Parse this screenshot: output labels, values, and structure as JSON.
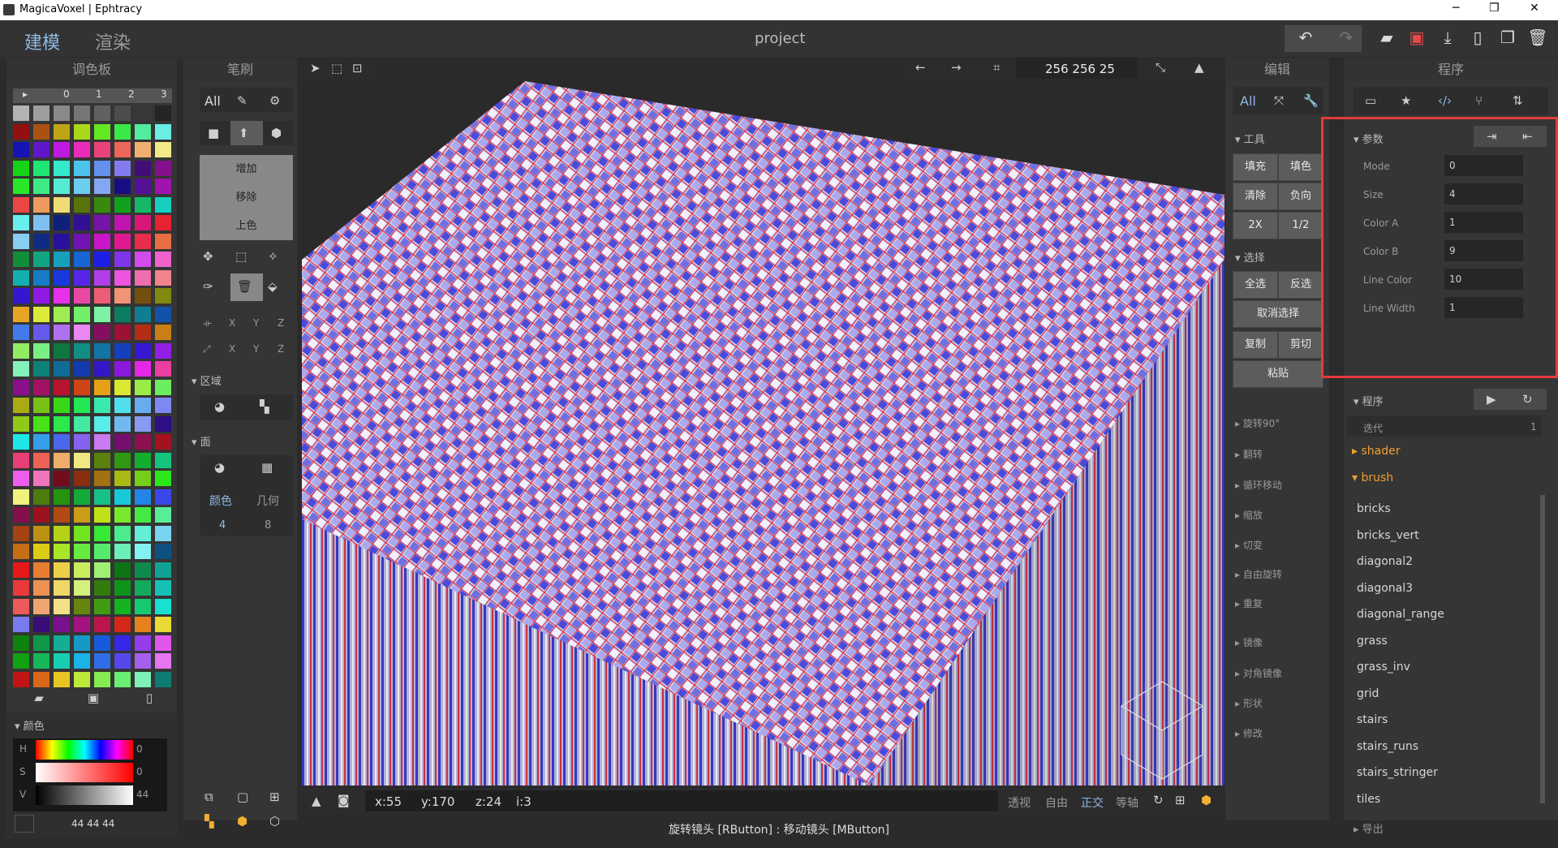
{
  "window": {
    "title": "MagicaVoxel | Ephtracy",
    "minimize": "─",
    "maximize": "❐",
    "close": "✕"
  },
  "topbar": {
    "tab_model": "建模",
    "tab_render": "渲染",
    "project": "project"
  },
  "palette": {
    "title": "调色板",
    "cols": [
      "▸",
      "0",
      "1",
      "2",
      "3"
    ],
    "selected_color": "#2b2b2b"
  },
  "brush": {
    "title": "笔刷",
    "all": "All",
    "modes": [
      "增加",
      "移除",
      "上色"
    ],
    "axes": [
      "X",
      "Y",
      "Z"
    ],
    "region_label": "区域",
    "face_label": "面",
    "face_color_label": "颜色",
    "face_geo_label": "几何",
    "face_color_val": "4",
    "face_geo_val": "8"
  },
  "color_panel": {
    "title": "颜色",
    "h_label": "H",
    "s_label": "S",
    "v_label": "V",
    "h_val": "0",
    "s_val": "0",
    "v_val": "44",
    "rgb": "44  44  44"
  },
  "viewport_bar": {
    "size": "256  256  25"
  },
  "coord_bar": {
    "x": "x:55",
    "y": "y:170",
    "z": "z:24",
    "i": "i:3"
  },
  "view_modes": [
    "透视",
    "自由",
    "正交",
    "等轴"
  ],
  "edit": {
    "title": "编辑",
    "all": "All",
    "tools_label": "工具",
    "tools": [
      "填充",
      "填色",
      "清除",
      "负向",
      "2X",
      "1/2"
    ],
    "select_label": "选择",
    "select": [
      "全选",
      "反选"
    ],
    "deselect": "取消选择",
    "copy": "复制",
    "cut": "剪切",
    "paste": "粘贴",
    "ops": [
      "旋转90°",
      "翻转",
      "循环移动",
      "缩放",
      "切变",
      "自由旋转",
      "重复",
      "镜像",
      "对角镜像",
      "形状",
      "修改"
    ]
  },
  "program": {
    "title": "程序",
    "params_label": "参数",
    "params": [
      {
        "label": "Mode",
        "value": "0"
      },
      {
        "label": "Size",
        "value": "4"
      },
      {
        "label": "Color A",
        "value": "1"
      },
      {
        "label": "Color B",
        "value": "9"
      },
      {
        "label": "Line Color",
        "value": "10"
      },
      {
        "label": "Line Width",
        "value": "1"
      }
    ],
    "program_label": "程序",
    "iter_label": "迭代",
    "iter_val": "1",
    "folders": [
      "shader",
      "brush"
    ],
    "items": [
      "bricks",
      "bricks_vert",
      "diagonal2",
      "diagonal3",
      "diagonal_range",
      "grass",
      "grass_inv",
      "grid",
      "stairs",
      "stairs_runs",
      "stairs_stringer",
      "tiles"
    ],
    "export_label": "导出"
  },
  "status": {
    "hint": "旋转镜头 [RButton] : 移动镜头 [MButton]"
  },
  "colors": {
    "accent": "#8fb8e6",
    "highlight_box": "#e53c3c",
    "folder": "#f0a030"
  }
}
